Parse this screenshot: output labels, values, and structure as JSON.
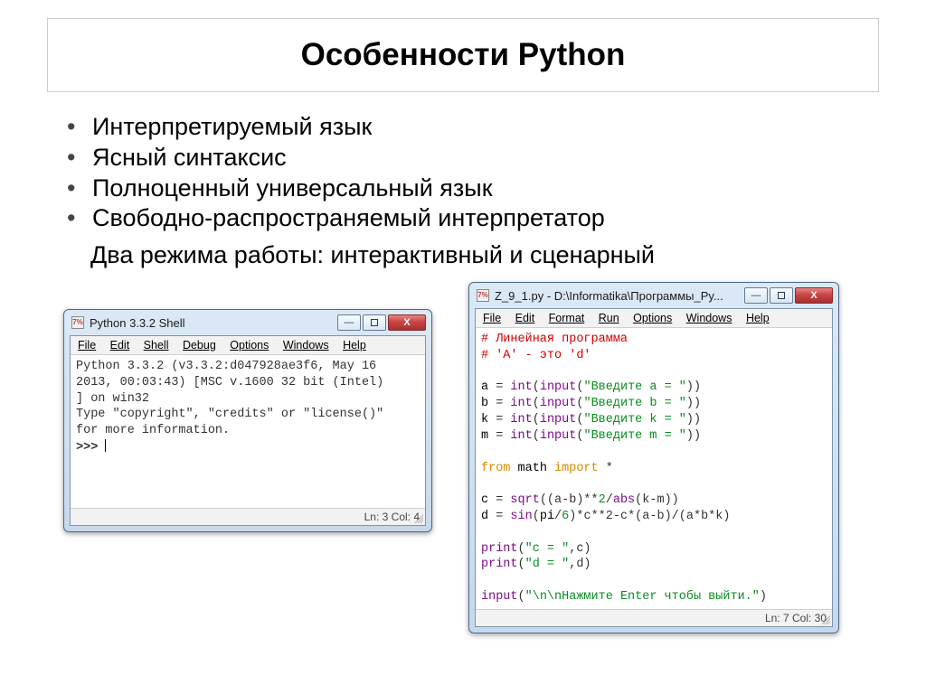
{
  "title": "Особенности Python",
  "bullets": [
    "Интерпретируемый язык",
    "Ясный синтаксис",
    "Полноценный универсальный язык",
    "Свободно-распространяемый интерпретатор"
  ],
  "subtitle": "Два режима работы: интерактивный и сценарный",
  "shell": {
    "title": "Python 3.3.2 Shell",
    "menus": [
      "File",
      "Edit",
      "Shell",
      "Debug",
      "Options",
      "Windows",
      "Help"
    ],
    "banner_l1": "Python 3.3.2 (v3.3.2:d047928ae3f6, May 16",
    "banner_l2": "2013, 00:03:43) [MSC v.1600 32 bit (Intel)",
    "banner_l3": "] on win32",
    "banner_l4": "Type \"copyright\", \"credits\" or \"license()\"",
    "banner_l5": "for more information.",
    "prompt": ">>> ",
    "status": "Ln: 3  Col: 4"
  },
  "editor": {
    "title": "Z_9_1.py - D:\\Informatika\\Программы_Py...",
    "menus": [
      "File",
      "Edit",
      "Format",
      "Run",
      "Options",
      "Windows",
      "Help"
    ],
    "status": "Ln: 7  Col: 30",
    "code": {
      "c1": "# Линейная программа",
      "c2": "# 'A' - это 'd'",
      "a": "a",
      "b": "b",
      "k": "k",
      "m": "m",
      "eq": " = ",
      "int_": "int",
      "input_": "input",
      "sa": "\"Введите a = \"",
      "sb": "\"Введите b = \"",
      "sk": "\"Введите k = \"",
      "sm": "\"Введите m = \"",
      "from": "from",
      "math": "math",
      "import": "import",
      "star": "*",
      "c": "c",
      "d": "d",
      "sqrt": "sqrt",
      "sin": "sin",
      "abs": "abs",
      "pi": "pi",
      "expr_c_inner1": "((a-b)**",
      "two": "2",
      "slash": "/",
      "expr_c_inner2": "(k-m))",
      "six": "6",
      "expr_d_rest": ")*c**2-c*(a-b)/(a*b*k)",
      "print_": "print",
      "sc": "\"c = \"",
      "sd": "\"d = \"",
      "comma_c": ",c)",
      "comma_d": ",d)",
      "final_str": "\"\\n\\nНажмите Enter чтобы выйти.\""
    }
  },
  "win_buttons": {
    "min": "—",
    "close": "Х"
  }
}
